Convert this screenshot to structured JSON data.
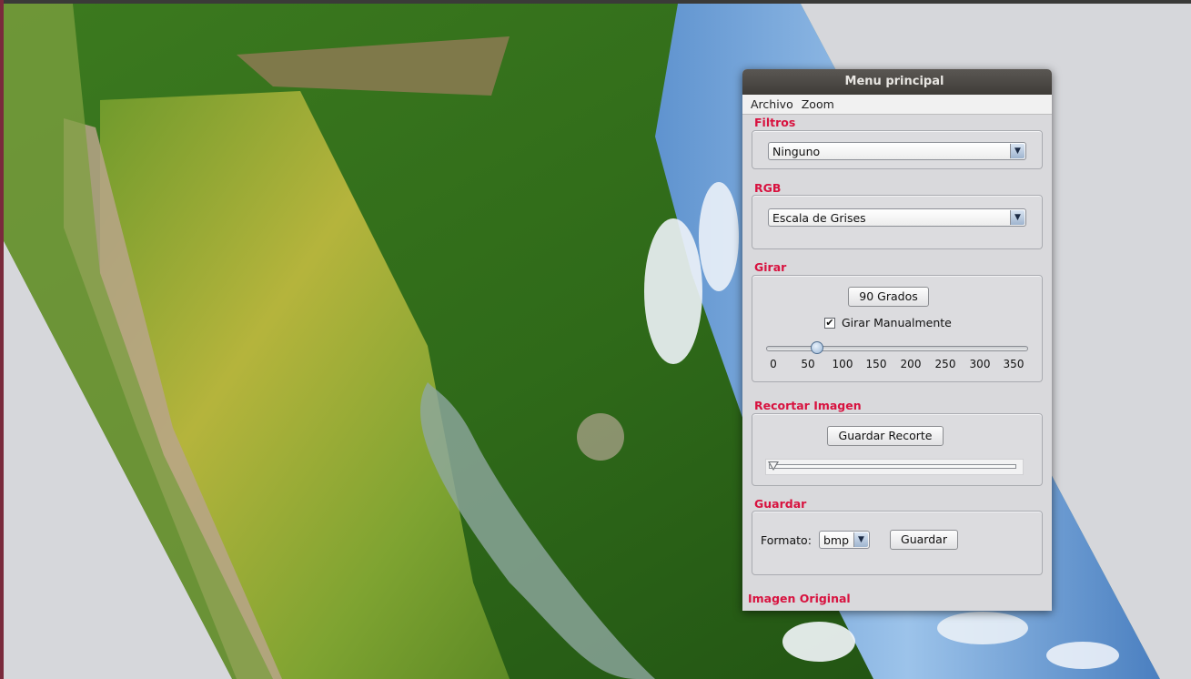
{
  "window": {
    "title": "Menu principal"
  },
  "menu": {
    "archivo": "Archivo",
    "zoom": "Zoom"
  },
  "filtros": {
    "title": "Filtros",
    "selected": "Ninguno"
  },
  "rgb": {
    "title": "RGB",
    "selected": "Escala de Grises"
  },
  "girar": {
    "title": "Girar",
    "button": "90 Grados",
    "checkbox_label": "Girar Manualmente",
    "checkbox_checked": true,
    "slider_value": 70,
    "slider_min": 0,
    "slider_max": 360,
    "ticks": [
      "0",
      "50",
      "100",
      "150",
      "200",
      "250",
      "300",
      "350"
    ]
  },
  "recortar": {
    "title": "Recortar Imagen",
    "button": "Guardar Recorte",
    "slider_value": 0
  },
  "guardar": {
    "title": "Guardar",
    "format_label": "Formato:",
    "format_selected": "bmp",
    "button": "Guardar"
  },
  "footer": {
    "label": "Imagen Original"
  },
  "colors": {
    "section_title": "#d8123f",
    "titlebar": "#4a4743",
    "dialog_bg": "#d9d9dc"
  }
}
